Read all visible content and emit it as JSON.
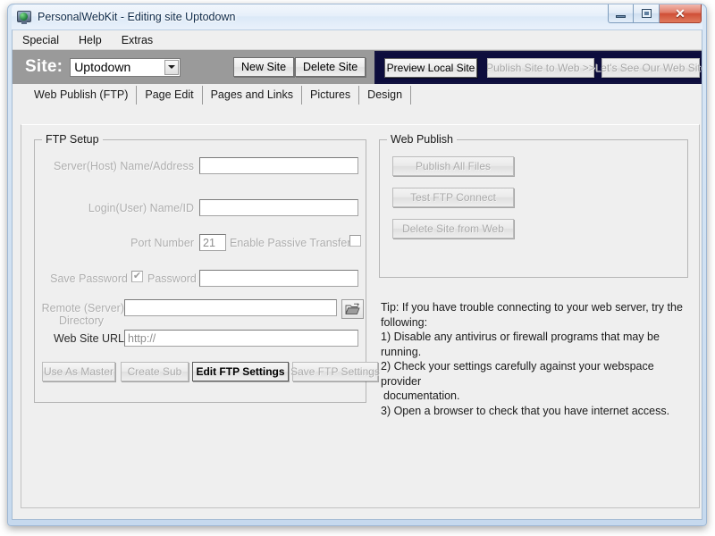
{
  "window": {
    "title": "PersonalWebKit - Editing site Uptodown",
    "app_icon": "monitor-globe-icon",
    "controls": {
      "minimize": "minimize-icon",
      "maximize": "maximize-icon",
      "close": "✕"
    }
  },
  "menubar": {
    "items": [
      {
        "label": "Special"
      },
      {
        "label": "Help"
      },
      {
        "label": "Extras"
      }
    ]
  },
  "toolbar": {
    "site_label": "Site:",
    "site_selected": "Uptodown",
    "site_dropdown_icon": "chevron-down-icon",
    "new_site_label": "New Site",
    "delete_site_label": "Delete Site",
    "action_panel": {
      "highlight_color": "#0d0d3d",
      "preview_local_label": "Preview Local Site",
      "publish_web_label": "Publish Site to Web >>",
      "see_website_label": "Let's See Our Web Site"
    }
  },
  "tabs": [
    {
      "label": "Web Publish (FTP)",
      "active": true
    },
    {
      "label": "Page Edit",
      "active": false
    },
    {
      "label": "Pages and Links",
      "active": false
    },
    {
      "label": "Pictures",
      "active": false
    },
    {
      "label": "Design",
      "active": false
    }
  ],
  "ftp_setup": {
    "group_title": "FTP Setup",
    "server_label": "Server(Host) Name/Address",
    "server_value": "",
    "login_label": "Login(User) Name/ID",
    "login_value": "",
    "port_label": "Port Number",
    "port_value": "21",
    "passive_label": "Enable Passive Transfer",
    "passive_checked": "",
    "save_password_label": "Save Password",
    "save_password_checked": "✔",
    "password_label": "Password",
    "password_value": "",
    "remote_dir_label_line1": "Remote (Server)",
    "remote_dir_label_line2": "Directory",
    "remote_dir_value": "",
    "browse_icon": "open-folder-icon",
    "url_label": "Web Site URL",
    "url_value": "http://",
    "buttons": {
      "use_as_master": "Use As Master",
      "create_sub": "Create Sub",
      "edit_ftp_settings": "Edit FTP Settings",
      "save_ftp_settings": "Save FTP Settings"
    }
  },
  "web_publish": {
    "group_title": "Web Publish",
    "publish_all_label": "Publish All Files",
    "test_ftp_label": "Test FTP Connect",
    "delete_site_web_label": "Delete Site from Web"
  },
  "tip": {
    "intro": "Tip: If you have trouble connecting to your web server, try the following:",
    "line1": "1) Disable any antivirus or firewall programs that may be running.",
    "line2": "2) Check your settings carefully against your webspace provider",
    "line2b": "documentation.",
    "line3": "3) Open a browser to check that you have internet access."
  }
}
